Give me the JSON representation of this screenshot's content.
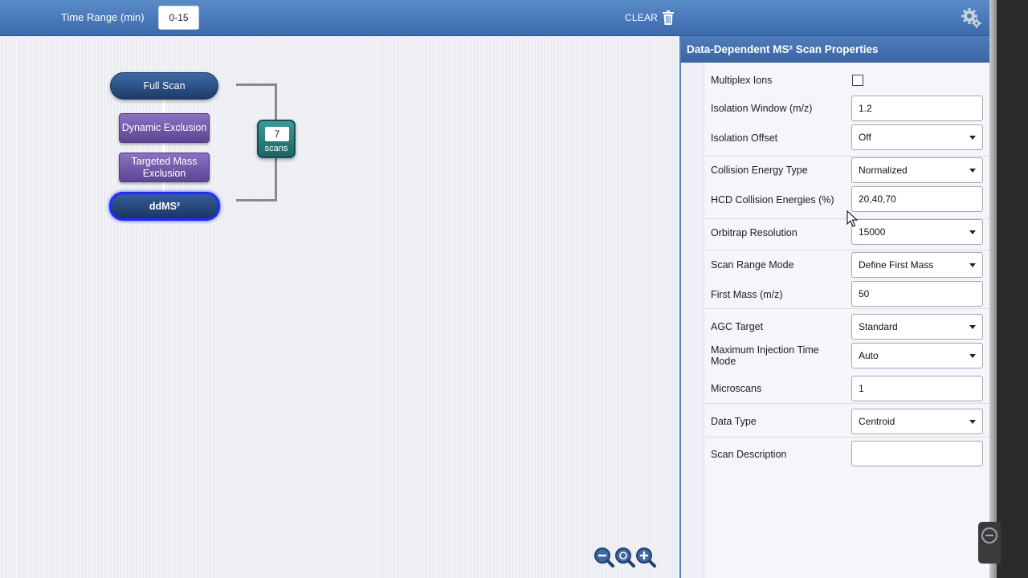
{
  "header": {
    "time_range_label": "Time Range (min)",
    "time_range_value": "0-15",
    "clear_label": "CLEAR",
    "icons": {
      "clear": "trash-icon",
      "settings": "gear-icon"
    }
  },
  "workflow": {
    "full_scan": "Full Scan",
    "dynamic_exclusion": "Dynamic Exclusion",
    "targeted_mass_exclusion": "Targeted Mass Exclusion",
    "ddms2": "ddMS²",
    "loop_count": "7",
    "loop_label": "scans",
    "zoom_icons": [
      "zoom-out-icon",
      "zoom-fit-icon",
      "zoom-in-icon"
    ]
  },
  "panel": {
    "title": "Data-Dependent MS² Scan Properties",
    "rows": [
      {
        "label": "Multiplex Ions",
        "type": "checkbox",
        "checked": false
      },
      {
        "label": "Isolation Window (m/z)",
        "type": "text",
        "value": "1.2"
      },
      {
        "label": "Isolation Offset",
        "type": "dropdown",
        "value": "Off"
      },
      {
        "label": "Collision Energy Type",
        "type": "dropdown",
        "value": "Normalized"
      },
      {
        "label": "HCD Collision Energies (%)",
        "type": "text",
        "value": "20,40,70"
      },
      {
        "label": "Orbitrap Resolution",
        "type": "dropdown",
        "value": "15000"
      },
      {
        "label": "Scan Range Mode",
        "type": "dropdown",
        "value": "Define First Mass"
      },
      {
        "label": "First Mass (m/z)",
        "type": "text",
        "value": "50"
      },
      {
        "label": "AGC Target",
        "type": "dropdown",
        "value": "Standard"
      },
      {
        "label": "Maximum Injection Time Mode",
        "type": "dropdown",
        "value": "Auto"
      },
      {
        "label": "Microscans",
        "type": "text",
        "value": "1"
      },
      {
        "label": "Data Type",
        "type": "dropdown",
        "value": "Centroid"
      },
      {
        "label": "Scan Description",
        "type": "text",
        "value": ""
      }
    ]
  },
  "colors": {
    "header_blue": "#4a79b9",
    "full_scan_node": "#2a4c82",
    "filter_node": "#7059a8",
    "ddms2_highlight": "#1f2cff",
    "loop_teal": "#2a7f7f"
  }
}
